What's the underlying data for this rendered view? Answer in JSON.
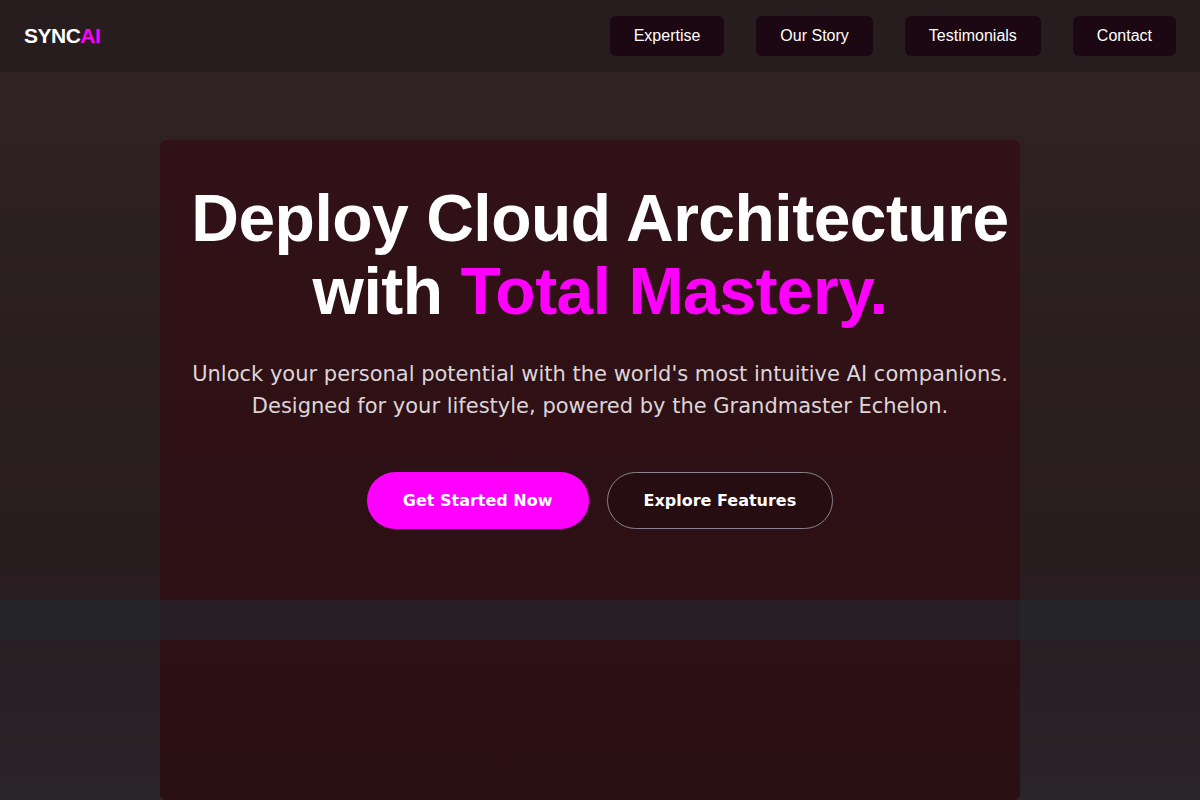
{
  "logo": {
    "text": "SYNC",
    "accent": "AI"
  },
  "nav": [
    "Expertise",
    "Our Story",
    "Testimonials",
    "Contact"
  ],
  "hero": {
    "headline": "Deploy Cloud Architecture with ",
    "headline_accent": "Total Mastery.",
    "subtitle": "Unlock your personal potential with the world's most intuitive AI companions. Designed for your lifestyle, powered by the Grandmaster Echelon.",
    "buttons": [
      "Get Started Now",
      "Explore Features"
    ]
  }
}
